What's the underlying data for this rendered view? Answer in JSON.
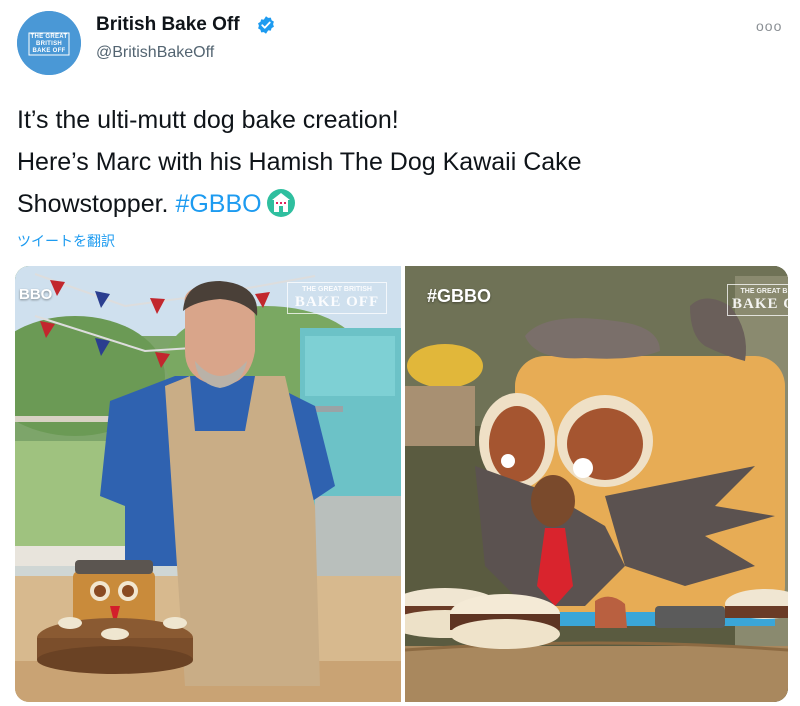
{
  "account": {
    "display_name": "British Bake Off",
    "handle": "@BritishBakeOff",
    "avatar_text": "THE GREAT BRITISH BAKE OFF"
  },
  "tweet": {
    "line1": "It’s the ulti-mutt dog bake creation!",
    "line2": "Here’s Marc with his Hamish The Dog Kawaii Cake",
    "line3_text": "Showstopper. ",
    "hashtag": "#GBBO",
    "translate_label": "ツイートを翻訳"
  },
  "media": {
    "left_photo": {
      "overlay_text": "BBO",
      "logo_top": "THE GREAT BRITISH",
      "logo_bottom": "BAKE OFF"
    },
    "right_photo": {
      "overlay_text": "#GBBO",
      "logo_top": "THE GREAT B",
      "logo_bottom": "BAKE O"
    }
  },
  "colors": {
    "link": "#1d9bf0",
    "verified": "#1d9bf0",
    "avatar_bg": "#4a98d6"
  },
  "icons": {
    "verified": "verified-badge-icon",
    "more": "more-options-icon",
    "castle": "gbbo-castle-emoji-icon"
  }
}
